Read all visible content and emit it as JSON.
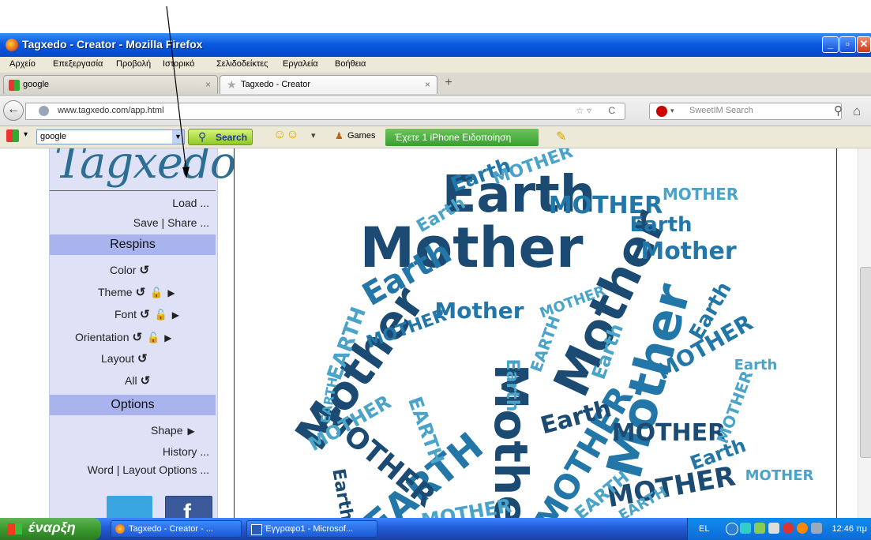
{
  "window": {
    "title": "Tagxedo - Creator - Mozilla Firefox"
  },
  "menu": [
    "Αρχείο",
    "Επεξεργασία",
    "Προβολή",
    "Ιστορικό",
    "Σελιδοδείκτες",
    "Εργαλεία",
    "Βοήθεια"
  ],
  "tabs": [
    {
      "label": "google",
      "active": false
    },
    {
      "label": "Tagxedo - Creator",
      "active": true
    }
  ],
  "tab_close": "×",
  "new_tab": "+",
  "nav": {
    "url": "www.tagxedo.com/app.html",
    "search_placeholder": "SweetIM Search"
  },
  "toolbar": {
    "combo_value": "google",
    "search_label": "Search",
    "games_label": "Games",
    "notification": "Έχετε 1 iPhone Ειδοποίηση"
  },
  "sidebar": {
    "logo": "Tagxedo",
    "load": "Load ...",
    "save_share": "Save | Share ...",
    "respins_header": "Respins",
    "respins": {
      "color": "Color",
      "theme": "Theme",
      "font": "Font",
      "orientation": "Orientation",
      "layout": "Layout",
      "all": "All"
    },
    "options_header": "Options",
    "options": {
      "shape": "Shape",
      "history": "History ...",
      "word_layout": "Word | Layout Options ..."
    }
  },
  "wordcloud": {
    "words": [
      "Mother",
      "Earth",
      "MOTHER",
      "EARTH"
    ],
    "colors": {
      "dark": "#1b4a72",
      "mid": "#2277a8",
      "light": "#4aa3c9"
    }
  },
  "taskbar": {
    "start_label": "έναρξη",
    "tasks": [
      "Tagxedo - Creator - ...",
      "Έγγραφο1 - Microsof..."
    ],
    "lang": "EL",
    "time": "12:46 πμ"
  },
  "colors": {
    "titlebar": "#0a5ae0",
    "sidebar_bg": "#dfe2f7",
    "sidebar_header": "#a9b3ee",
    "logo": "#2d6e93"
  }
}
